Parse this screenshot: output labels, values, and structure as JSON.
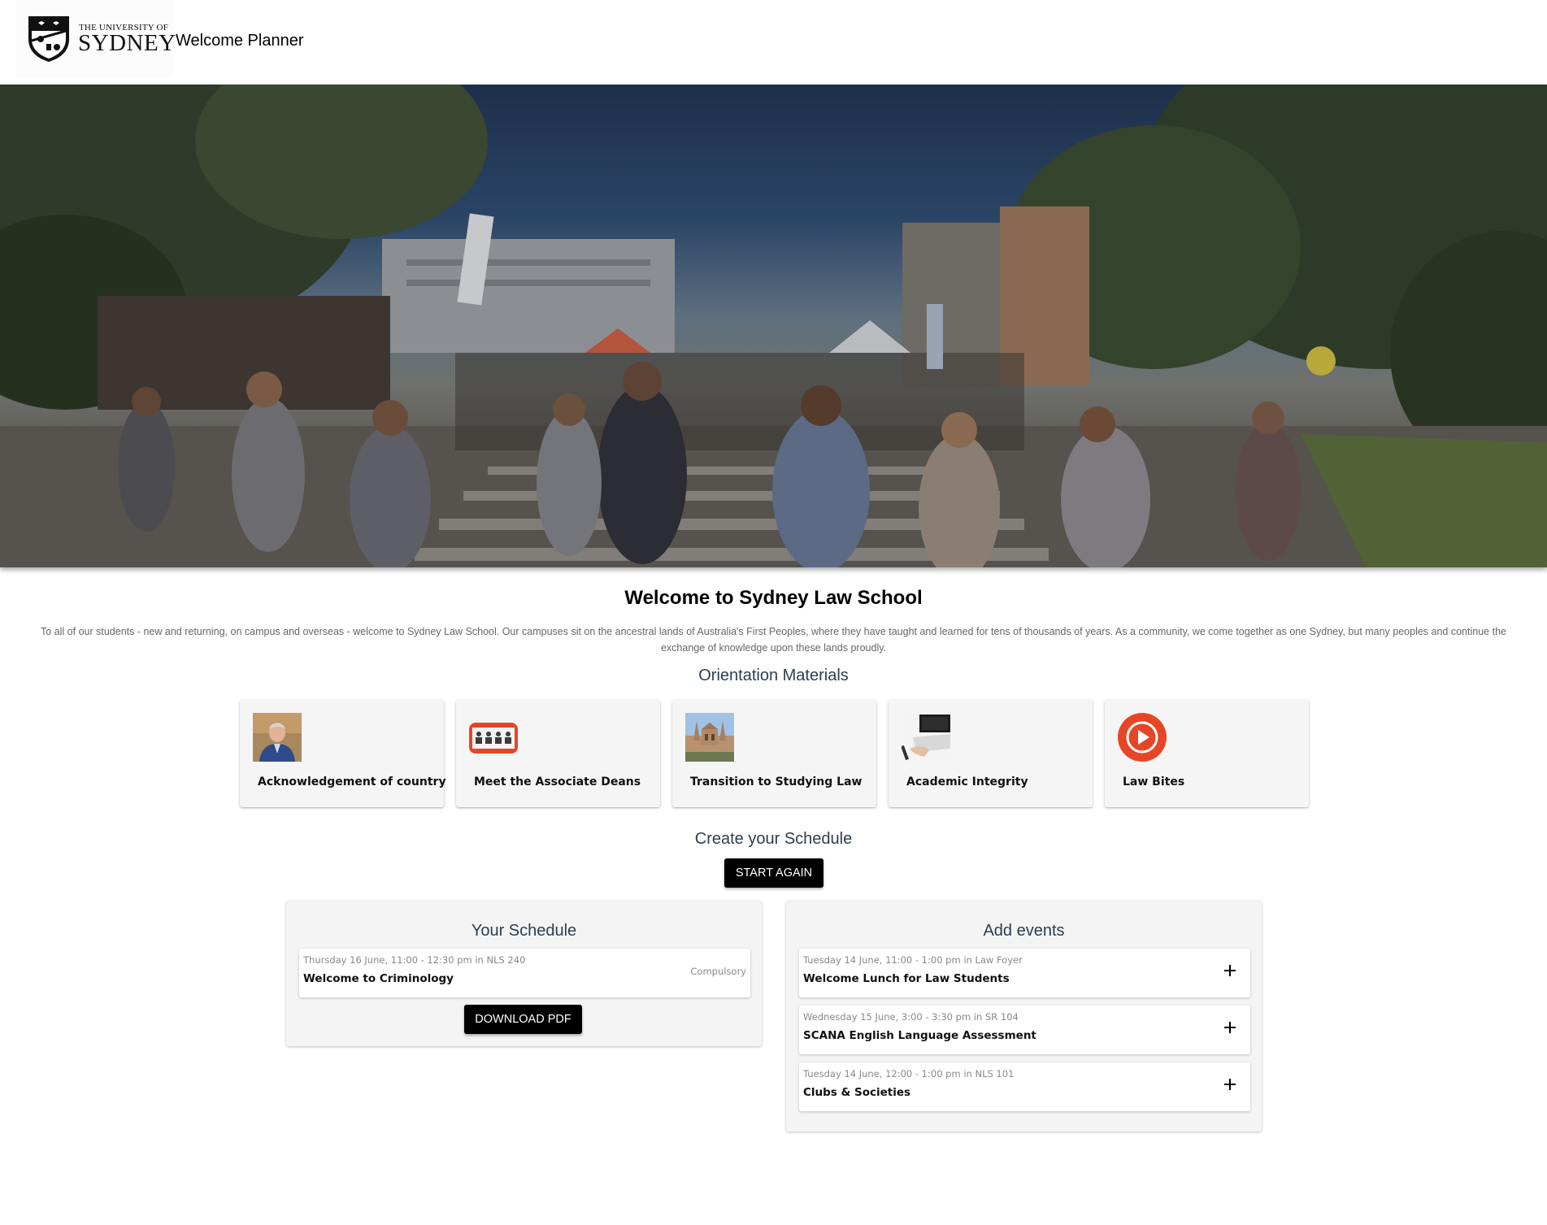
{
  "header": {
    "logo_small": "THE UNIVERSITY OF",
    "logo_big": "SYDNEY",
    "app_title": "Welcome Planner"
  },
  "intro": {
    "title": "Welcome to Sydney Law School",
    "text": "To all of our students - new and returning, on campus and overseas - welcome to Sydney Law School. Our campuses sit on the ancestral lands of Australia's First Peoples, where they have taught and learned for tens of thousands of years. As a community, we come together as one Sydney, but many peoples and continue the exchange of knowledge upon these lands proudly."
  },
  "orientation": {
    "title": "Orientation Materials",
    "cards": [
      {
        "label": "Acknowledgement of country",
        "icon": "portrait-photo-icon"
      },
      {
        "label": "Meet the Associate Deans",
        "icon": "video-call-photo-icon"
      },
      {
        "label": "Transition to Studying Law",
        "icon": "building-photo-icon"
      },
      {
        "label": "Academic Integrity",
        "icon": "laptop-photo-icon"
      },
      {
        "label": "Law Bites",
        "icon": "play-circle-icon"
      }
    ]
  },
  "schedule": {
    "title": "Create your Schedule",
    "start_again": "START AGAIN",
    "your_schedule": {
      "title": "Your Schedule",
      "events": [
        {
          "meta": "Thursday 16 June, 11:00 - 12:30 pm in NLS 240",
          "name": "Welcome to Criminology",
          "tag": "Compulsory"
        }
      ],
      "download": "DOWNLOAD PDF"
    },
    "add_events": {
      "title": "Add events",
      "events": [
        {
          "meta": "Tuesday 14 June, 11:00 - 1:00 pm in Law Foyer",
          "name": "Welcome Lunch for Law Students"
        },
        {
          "meta": "Wednesday 15 June, 3:00 - 3:30 pm in SR 104",
          "name": "SCANA English Language Assessment"
        },
        {
          "meta": "Tuesday 14 June, 12:00 - 1:00 pm in NLS 101",
          "name": "Clubs & Societies"
        }
      ]
    }
  },
  "colors": {
    "accent_red": "#e64626",
    "button_black": "#000000",
    "heading_slate": "#2c3e50"
  }
}
